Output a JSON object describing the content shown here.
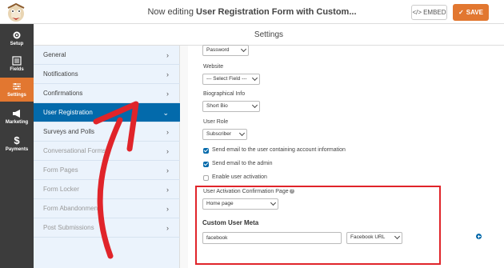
{
  "header": {
    "title_prefix": "Now editing ",
    "title_form": "User Registration Form with Custom...",
    "embed_label": "EMBED",
    "save_label": "SAVE"
  },
  "iconbar": {
    "items": [
      {
        "label": "Setup",
        "icon": "gear-icon"
      },
      {
        "label": "Fields",
        "icon": "list-icon"
      },
      {
        "label": "Settings",
        "icon": "sliders-icon"
      },
      {
        "label": "Marketing",
        "icon": "megaphone-icon"
      },
      {
        "label": "Payments",
        "icon": "dollar-icon"
      }
    ],
    "active": "Settings"
  },
  "settings_header": "Settings",
  "menu": {
    "items": [
      {
        "label": "General",
        "state": "normal"
      },
      {
        "label": "Notifications",
        "state": "normal"
      },
      {
        "label": "Confirmations",
        "state": "normal"
      },
      {
        "label": "User Registration",
        "state": "active"
      },
      {
        "label": "Surveys and Polls",
        "state": "normal"
      },
      {
        "label": "Conversational Forms",
        "state": "dim"
      },
      {
        "label": "Form Pages",
        "state": "dim"
      },
      {
        "label": "Form Locker",
        "state": "dim"
      },
      {
        "label": "Form Abandonment",
        "state": "dim"
      },
      {
        "label": "Post Submissions",
        "state": "dim"
      }
    ]
  },
  "content": {
    "password_select": "Password",
    "website_label": "Website",
    "website_select": "--- Select Field ---",
    "bio_label": "Biographical Info",
    "bio_select": "Short Bio",
    "role_label": "User Role",
    "role_select": "Subscriber",
    "check_user_email": "Send email to the user containing account information",
    "check_admin_email": "Send email to the admin",
    "check_activation": "Enable user activation",
    "check_states": [
      true,
      true,
      false
    ],
    "activation_page_label": "User Activation Confirmation Page",
    "help_icon": "?",
    "activation_page_select": "Home page",
    "custom_meta_title": "Custom User Meta",
    "meta_key_value": "facebook",
    "meta_field_select": "Facebook URL"
  },
  "colors": {
    "accent": "#e27730",
    "active_blue": "#036aab",
    "annotation_red": "#e0242a"
  }
}
